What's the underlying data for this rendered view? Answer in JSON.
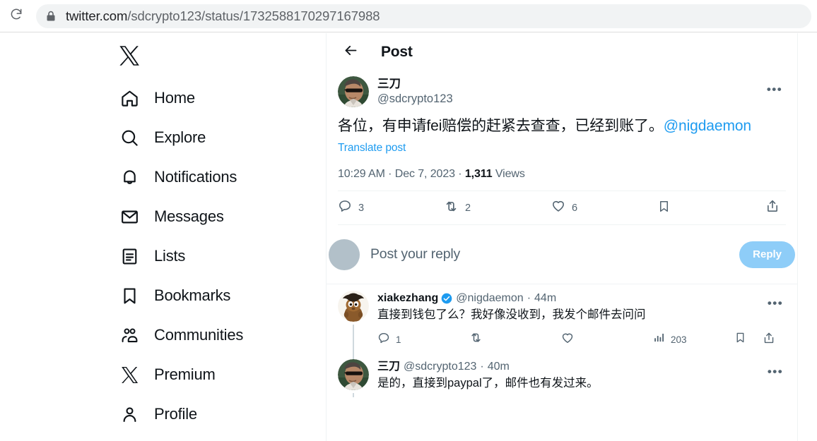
{
  "browser": {
    "url_full": "twitter.com/sdcrypto123/status/1732588170297167988",
    "url_host": "twitter.com",
    "url_path": "/sdcrypto123/status/1732588170297167988",
    "reload_icon": "reload-icon",
    "lock_icon": "lock-icon"
  },
  "sidebar": {
    "logo": "x-logo",
    "items": [
      {
        "label": "Home",
        "icon": "home-icon"
      },
      {
        "label": "Explore",
        "icon": "search-icon"
      },
      {
        "label": "Notifications",
        "icon": "bell-icon"
      },
      {
        "label": "Messages",
        "icon": "envelope-icon"
      },
      {
        "label": "Lists",
        "icon": "list-icon"
      },
      {
        "label": "Bookmarks",
        "icon": "bookmark-icon"
      },
      {
        "label": "Communities",
        "icon": "communities-icon"
      },
      {
        "label": "Premium",
        "icon": "x-icon"
      },
      {
        "label": "Profile",
        "icon": "person-icon"
      }
    ]
  },
  "header": {
    "back_icon": "back-arrow-icon",
    "title": "Post"
  },
  "post": {
    "author_name": "三刀",
    "author_handle": "@sdcrypto123",
    "avatar": "photo-avatar-sunglasses",
    "more_icon": "more-options-icon",
    "text": "各位，有申请fei赔偿的赶紧去查查，已经到账了。",
    "mention": "@nigdaemon",
    "translate_label": "Translate post",
    "time": "10:29 AM",
    "date": "Dec 7, 2023",
    "views_count": "1,311",
    "views_label": "Views",
    "meta_sep": " · ",
    "actions": [
      {
        "icon": "reply-icon",
        "name": "reply-action",
        "count": "3"
      },
      {
        "icon": "retweet-icon",
        "name": "repost-action",
        "count": "2"
      },
      {
        "icon": "heart-icon",
        "name": "like-action",
        "count": "6"
      },
      {
        "icon": "bookmark-icon",
        "name": "bookmark-action",
        "count": ""
      },
      {
        "icon": "share-icon",
        "name": "share-action",
        "count": ""
      }
    ]
  },
  "composer": {
    "avatar": "default-avatar",
    "placeholder": "Post your reply",
    "button_label": "Reply",
    "button_color": "#8ecdf8"
  },
  "replies": [
    {
      "name": "xiakezhang",
      "verified": true,
      "handle": "@nigdaemon",
      "time": "44m",
      "separator": "·",
      "avatar": "cartoon-avatar-brown",
      "text": "直接到钱包了么？我好像没收到，我发个邮件去问问",
      "more_icon": "more-options-icon",
      "actions": [
        {
          "icon": "reply-icon",
          "name": "reply-action",
          "count": "1"
        },
        {
          "icon": "retweet-icon",
          "name": "repost-action",
          "count": ""
        },
        {
          "icon": "heart-icon",
          "name": "like-action",
          "count": ""
        },
        {
          "icon": "analytics-icon",
          "name": "views-action",
          "count": "203"
        },
        {
          "icon": "bookmark-icon",
          "name": "bookmark-action",
          "count": ""
        },
        {
          "icon": "share-icon",
          "name": "share-action",
          "count": ""
        }
      ]
    },
    {
      "name": "三刀",
      "verified": false,
      "handle": "@sdcrypto123",
      "time": "40m",
      "separator": "·",
      "avatar": "photo-avatar-sunglasses",
      "text": "是的，直接到paypal了，邮件也有发过来。",
      "more_icon": "more-options-icon",
      "actions": []
    }
  ],
  "colors": {
    "accent_blue": "#1d9bf0",
    "verified_blue": "#1d9bf0",
    "text_primary": "#0f1419",
    "text_secondary": "#536471",
    "border": "#eff3f4",
    "thread_line": "#cfd9de"
  }
}
